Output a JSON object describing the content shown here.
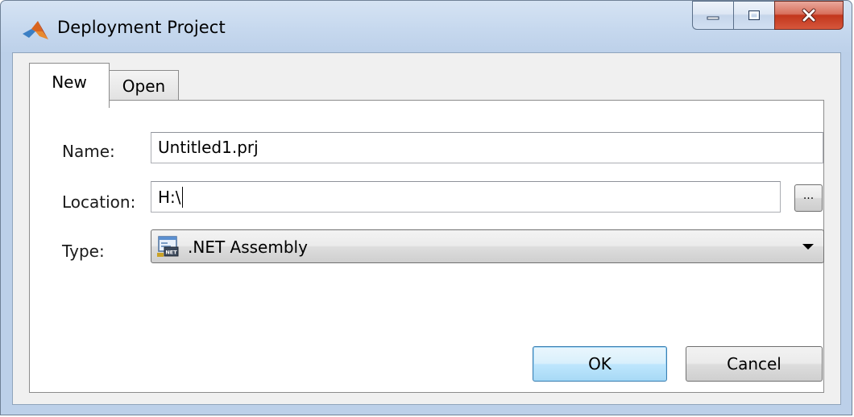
{
  "window": {
    "title": "Deployment Project",
    "app_icon": "matlab-logo-icon",
    "caption_buttons": [
      "minimize-icon",
      "maximize-icon",
      "close-icon"
    ]
  },
  "tabs": [
    {
      "label": "New",
      "selected": true
    },
    {
      "label": "Open",
      "selected": false
    }
  ],
  "form": {
    "name_label": "Name:",
    "name_value": "Untitled1.prj",
    "location_label": "Location:",
    "location_value": "H:\\",
    "browse_label": "...",
    "type_label": "Type:",
    "type_value": ".NET Assembly",
    "type_icon": "net-assembly-icon"
  },
  "buttons": {
    "ok": "OK",
    "cancel": "Cancel"
  },
  "colors": {
    "window_frame": "#c6d8ee",
    "close_button": "#c2361c",
    "default_button_border": "#3c7fb1"
  }
}
